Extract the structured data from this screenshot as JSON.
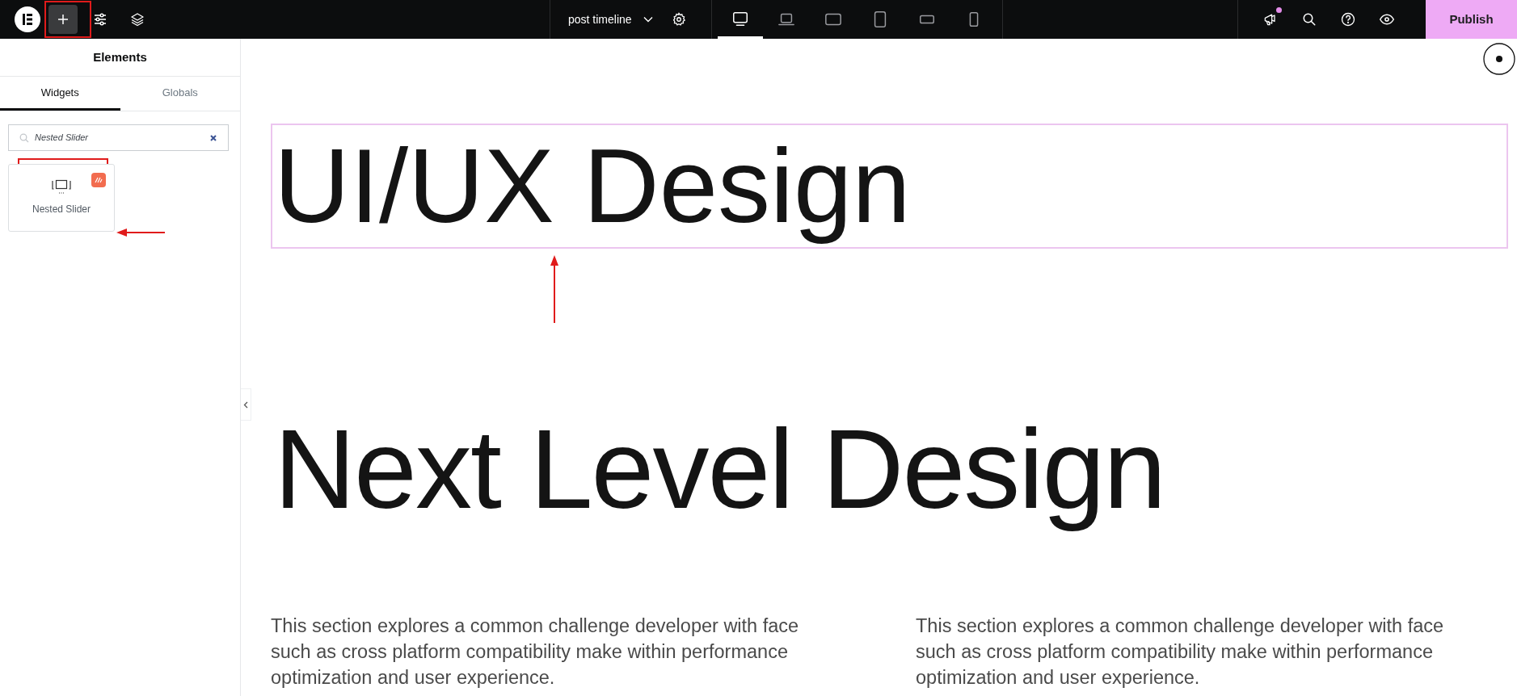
{
  "topbar": {
    "page_title": "post timeline",
    "devices": [
      {
        "kind": "desktop",
        "selected": true
      },
      {
        "kind": "laptop",
        "selected": false
      },
      {
        "kind": "tablet-landscape",
        "selected": false
      },
      {
        "kind": "tablet",
        "selected": false
      },
      {
        "kind": "mobile-landscape",
        "selected": false
      },
      {
        "kind": "mobile",
        "selected": false
      }
    ],
    "notification": true,
    "publish": "Publish"
  },
  "sidebar": {
    "title": "Elements",
    "tabs": [
      {
        "label": "Widgets",
        "selected": true
      },
      {
        "label": "Globals",
        "selected": false
      }
    ],
    "search": {
      "value": "Nested Slider"
    },
    "widgets": [
      {
        "label": "Nested Slider",
        "pro": true
      }
    ]
  },
  "canvas": {
    "headings": [
      {
        "text": "UI/UX Design",
        "selected": true
      },
      {
        "text": "Next Level Design",
        "selected": false
      }
    ],
    "paragraphs": [
      "This section explores a common challenge developer with face such as cross platform compatibility make within performance optimization and user experience.",
      "This section explores a common challenge developer with face such as cross platform compatibility make within performance optimization and user experience."
    ]
  }
}
